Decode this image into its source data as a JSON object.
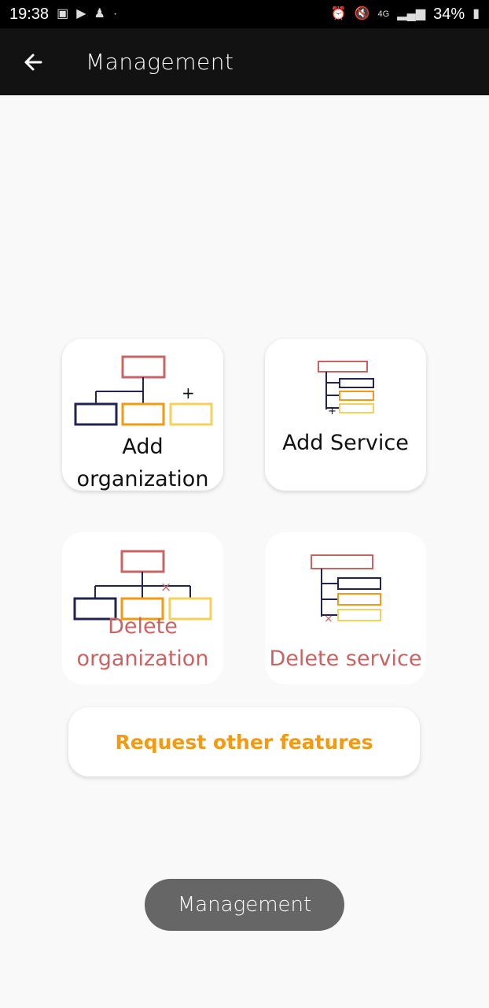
{
  "status_bar": {
    "time": "19:38",
    "battery": "34%",
    "network": "4G",
    "left_icons": [
      "image-icon",
      "youtube-icon",
      "notification-icon",
      "dot-icon"
    ],
    "right_icons": [
      "alarm-icon",
      "mute-icon",
      "signal-icon",
      "battery-icon"
    ]
  },
  "app_bar": {
    "title": "Management"
  },
  "cards": {
    "add_org": "Add organization",
    "add_service": "Add Service",
    "delete_org": "Delete organization",
    "delete_service": "Delete service"
  },
  "request_button": "Request other features",
  "toast": "Management",
  "colors": {
    "accent_orange": "#f29a12",
    "delete_red": "#c96464",
    "navy": "#23244e",
    "pale_yellow": "#f2d15c"
  }
}
